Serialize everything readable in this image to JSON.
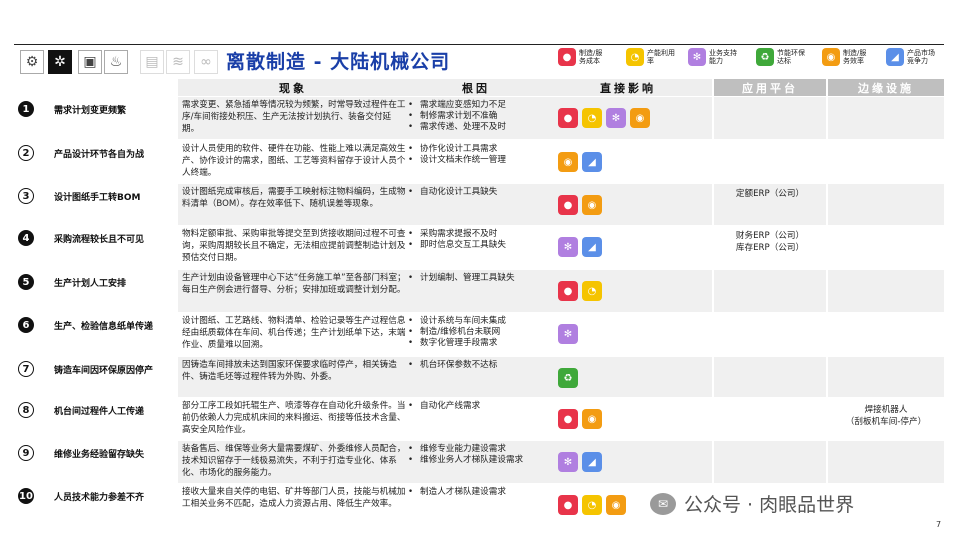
{
  "header": {
    "title": "离散制造 - 大陆机械公司",
    "industry_icons": [
      {
        "name": "robot-arm-icon",
        "glyph": "⚙",
        "state": "normal"
      },
      {
        "name": "gears-icon",
        "glyph": "✲",
        "state": "active"
      },
      {
        "name": "machine-icon",
        "glyph": "▣",
        "state": "normal"
      },
      {
        "name": "flame-icon",
        "glyph": "♨",
        "state": "normal"
      },
      {
        "name": "server-icon",
        "glyph": "▤",
        "state": "faded"
      },
      {
        "name": "waves-icon",
        "glyph": "≋",
        "state": "faded"
      },
      {
        "name": "link-icon",
        "glyph": "∞",
        "state": "faded"
      }
    ]
  },
  "legend": [
    {
      "key": "cost",
      "label": "制造/服务成本",
      "color": "#e8344a",
      "glyph": "●",
      "icon": "cost-icon"
    },
    {
      "key": "capacity",
      "label": "产能利用率",
      "color": "#f5c400",
      "glyph": "◔",
      "icon": "capacity-clock-icon"
    },
    {
      "key": "support",
      "label": "业务支持能力",
      "color": "#b07fe0",
      "glyph": "✻",
      "icon": "support-icon"
    },
    {
      "key": "eco",
      "label": "节能环保达标",
      "color": "#3fa83a",
      "glyph": "♻",
      "icon": "eco-icon"
    },
    {
      "key": "efficiency",
      "label": "制造/服务效率",
      "color": "#f39c12",
      "glyph": "◉",
      "icon": "efficiency-icon"
    },
    {
      "key": "market",
      "label": "产品市场竞争力",
      "color": "#5b8fe8",
      "glyph": "◢",
      "icon": "market-icon"
    }
  ],
  "columns": {
    "phenomenon": "现象",
    "cause": "根因",
    "impact": "直接影响",
    "platform": "应用平台",
    "edge": "边缘设施"
  },
  "rows": [
    {
      "no": "1",
      "style": "filled",
      "issue": "需求计划变更频繁",
      "phenomenon": "需求变更、紧急插单等情况较为频繁，时常导致过程件在工序/车间衔接处积压、生产无法按计划执行、装备交付延期。",
      "causes": [
        "需求端应变感知力不足",
        "制修需求计划不准确",
        "需求传递、处理不及时"
      ],
      "impacts": [
        "cost",
        "capacity",
        "support",
        "efficiency"
      ],
      "platform": "",
      "edge": ""
    },
    {
      "no": "2",
      "style": "outline",
      "issue": "产品设计环节各自为战",
      "phenomenon": "设计人员使用的软件、硬件在功能、性能上难以满足高效生产、协作设计的需求，图纸、工艺等资料留存于设计人员个人终端。",
      "causes": [
        "协作化设计工具需求",
        "设计文档未作统一管理"
      ],
      "impacts": [
        "efficiency",
        "market"
      ],
      "platform": "",
      "edge": ""
    },
    {
      "no": "3",
      "style": "outline",
      "issue": "设计图纸手工转BOM",
      "phenomenon": "设计图纸完成审核后，需要手工映射标注物料编码，生成物料清单（BOM）。存在效率低下、随机误差等现象。",
      "causes": [
        "自动化设计工具缺失"
      ],
      "impacts": [
        "cost",
        "efficiency"
      ],
      "platform": "定额ERP（公司）",
      "edge": ""
    },
    {
      "no": "4",
      "style": "filled",
      "issue": "采购流程较长且不可见",
      "phenomenon": "物料定额审批、采购审批等提交至到货接收期间过程不可查询，采购周期较长且不确定，无法相应提前调整制造计划及预估交付日期。",
      "causes": [
        "采购需求提报不及时",
        "即时信息交互工具缺失"
      ],
      "impacts": [
        "support",
        "market"
      ],
      "platform": "财务ERP（公司）\n库存ERP（公司）",
      "edge": ""
    },
    {
      "no": "5",
      "style": "filled",
      "issue": "生产计划人工安排",
      "phenomenon": "生产计划由设备管理中心下达“任务施工单”至各部门科室；每日生产例会进行督导、分析；安排加班或调整计划分配。",
      "causes": [
        "计划编制、管理工具缺失"
      ],
      "impacts": [
        "cost",
        "capacity"
      ],
      "platform": "",
      "edge": ""
    },
    {
      "no": "6",
      "style": "filled",
      "issue": "生产、检验信息纸单传递",
      "phenomenon": "设计图纸、工艺路线、物料清单、检验记录等生产过程信息经由纸质载体在车间、机台传递；生产计划纸单下达，末端作业、质量难以回溯。",
      "causes": [
        "设计系统与车间未集成",
        "制造/维修机台未联网",
        "数字化管理手段需求"
      ],
      "impacts": [
        "support"
      ],
      "platform": "",
      "edge": ""
    },
    {
      "no": "7",
      "style": "outline",
      "issue": "铸造车间因环保原因停产",
      "phenomenon": "因铸造车间排放未达到国家环保要求临时停产，相关铸造件、铸造毛坯等过程件转为外购、外委。",
      "causes": [
        "机台环保参数不达标"
      ],
      "impacts": [
        "eco"
      ],
      "platform": "",
      "edge": ""
    },
    {
      "no": "8",
      "style": "outline",
      "issue": "机台间过程件人工传递",
      "phenomenon": "部分工序工段如托辊生产、喷漆等存在自动化升级条件。当前仍依赖人力完成机床间的来料搬运、衔接等低技术含量、高安全风险作业。",
      "causes": [
        "自动化产线需求"
      ],
      "impacts": [
        "cost",
        "efficiency"
      ],
      "platform": "",
      "edge": "焊接机器人\n（刮板机车间-停产）"
    },
    {
      "no": "9",
      "style": "outline",
      "issue": "维修业务经验留存缺失",
      "phenomenon": "装备售后、维保等业务大量需要煤矿、外委维修人员配合，技术知识留存于一线极易流失，不利于打造专业化、体系化、市场化的服务能力。",
      "causes": [
        "维修专业能力建设需求",
        "维修业务人才梯队建设需求"
      ],
      "impacts": [
        "support",
        "market"
      ],
      "platform": "",
      "edge": ""
    },
    {
      "no": "10",
      "style": "filled",
      "issue": "人员技术能力参差不齐",
      "phenomenon": "接收大量来自关停的电铝、矿井等部门人员，技能与机械加工相关业务不匹配，造成人力资源占用、降低生产效率。",
      "causes": [
        "制造人才梯队建设需求"
      ],
      "impacts": [
        "cost",
        "capacity",
        "efficiency"
      ],
      "platform": "",
      "edge": ""
    }
  ],
  "watermark": "公众号 · 肉眼品世界",
  "page_number": "7"
}
